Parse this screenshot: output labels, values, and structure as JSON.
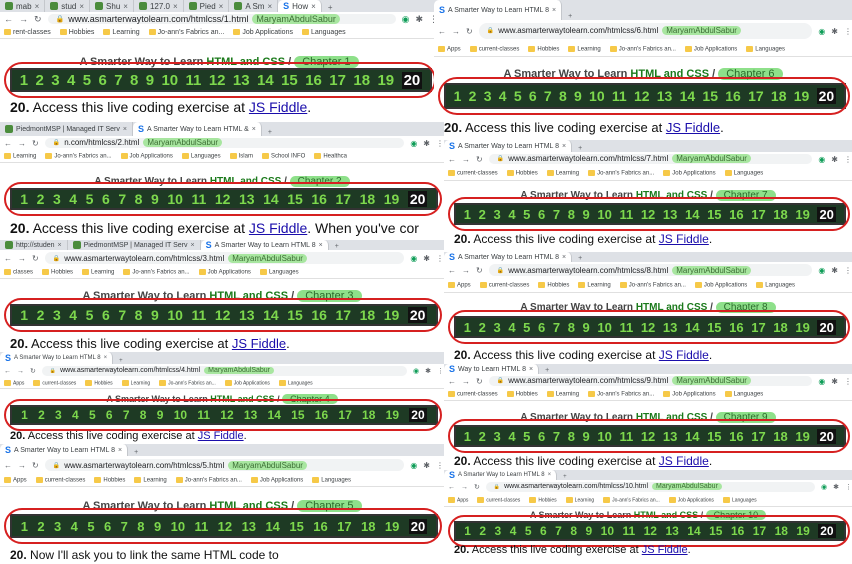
{
  "shots": [
    {
      "tabs": [
        "mab",
        "stud",
        "Shu",
        "127.0",
        "Pied",
        "A Sm",
        "How"
      ],
      "url": "www.asmarterwaytolearn.com/htmlcss/1.html",
      "user": "MaryamAbdulSabur",
      "bookmarks": [
        "rent-classes",
        "Hobbies",
        "Learning",
        "Jo-ann's Fabrics an...",
        "Job Applications",
        "Languages"
      ],
      "title_prefix": "A Smarter Way to Learn",
      "title_highlight": "HTML and CSS",
      "chapter": "Chapter 1",
      "exercise_num": "20.",
      "exercise_text": "Access this live coding exercise at",
      "link_text": "JS Fiddle",
      "trailing": "."
    },
    {
      "tabs": [
        "A Smarter Way to Learn HTML 8"
      ],
      "url": "www.asmarterwaytolearn.com/htmlcss/6.html",
      "user": "MaryamAbdulSabur",
      "bookmarks": [
        "Apps",
        "current-classes",
        "Hobbies",
        "Learning",
        "Jo-ann's Fabrics an...",
        "Job Applications",
        "Languages"
      ],
      "title_prefix": "A Smarter Way to Learn",
      "title_highlight": "HTML and CSS",
      "chapter": "Chapter 6",
      "exercise_num": "20.",
      "exercise_text": "Access this live coding exercise at",
      "link_text": "JS Fiddle",
      "trailing": "."
    },
    {
      "tabs": [
        "PiedmontMSP | Managed IT Serv",
        "A Smarter Way to Learn HTML &"
      ],
      "url": "n.com/htmlcss/2.html",
      "user": "MaryamAbdulSabur",
      "bookmarks": [
        "Learning",
        "Jo-ann's Fabrics an...",
        "Job Applications",
        "Languages",
        "Islam",
        "School INFO",
        "Healthca"
      ],
      "title_prefix": "A Smarter Way to Learn",
      "title_highlight": "HTML and CSS",
      "chapter": "Chapter 2",
      "exercise_num": "20.",
      "exercise_text": "Access this live coding exercise at",
      "link_text": "JS Fiddle",
      "trailing": ". When you've cor"
    },
    {
      "tabs": [
        "A Smarter Way to Learn HTML 8"
      ],
      "url": "www.asmarterwaytolearn.com/htmlcss/7.html",
      "user": "MaryamAbdulSabur",
      "bookmarks": [
        "current-classes",
        "Hobbies",
        "Learning",
        "Jo-ann's Fabrics an...",
        "Job Applications",
        "Languages"
      ],
      "title_prefix": "A Smarter Way to Learn",
      "title_highlight": "HTML and CSS",
      "chapter": "Chapter 7",
      "exercise_num": "20.",
      "exercise_text": "Access this live coding exercise at",
      "link_text": "JS Fiddle",
      "trailing": "."
    },
    {
      "tabs": [
        "http://studen",
        "PiedmontMSP | Managed IT Serv",
        "A Smarter Way to Learn HTML 8"
      ],
      "url": "www.asmarterwaytolearn.com/htmlcss/3.html",
      "user": "MaryamAbdulSabur",
      "bookmarks": [
        "classes",
        "Hobbies",
        "Learning",
        "Jo-ann's Fabrics an...",
        "Job Applications",
        "Languages"
      ],
      "title_prefix": "A Smarter Way to Learn",
      "title_highlight": "HTML and CSS",
      "chapter": "Chapter 3",
      "exercise_num": "20.",
      "exercise_text": "Access this live coding exercise at",
      "link_text": "JS Fiddle",
      "trailing": "."
    },
    {
      "tabs": [
        "A Smarter Way to Learn HTML 8"
      ],
      "url": "www.asmarterwaytolearn.com/htmlcss/8.html",
      "user": "MaryamAbdulSabur",
      "bookmarks": [
        "Apps",
        "current-classes",
        "Hobbies",
        "Learning",
        "Jo-ann's Fabrics an...",
        "Job Applications",
        "Languages"
      ],
      "title_prefix": "A Smarter Way to Learn",
      "title_highlight": "HTML and CSS",
      "chapter": "Chapter 8",
      "exercise_num": "20.",
      "exercise_text": "Access this live coding exercise at",
      "link_text": "JS Fiddle",
      "trailing": "."
    },
    {
      "tabs": [
        "A Smarter Way to Learn HTML 8"
      ],
      "url": "www.asmarterwaytolearn.com/htmlcss/4.html",
      "user": "MaryamAbdulSabur",
      "bookmarks": [
        "Apps",
        "current-classes",
        "Hobbies",
        "Learning",
        "Jo-ann's Fabrics an...",
        "Job Applications",
        "Languages"
      ],
      "title_prefix": "A Smarter Way to Learn",
      "title_highlight": "HTML and CSS",
      "chapter": "Chapter 4",
      "exercise_num": "20.",
      "exercise_text": "Access this live coding exercise at",
      "link_text": "JS Fiddle",
      "trailing": "."
    },
    {
      "tabs": [
        "Way to Learn HTML 8"
      ],
      "url": "www.asmarterwaytolearn.com/htmlcss/9.html",
      "user": "MaryamAbdulSabur",
      "bookmarks": [
        "current-classes",
        "Hobbies",
        "Learning",
        "Jo-ann's Fabrics an...",
        "Job Applications",
        "Languages"
      ],
      "title_prefix": "A Smarter Way to Learn",
      "title_highlight": "HTML and CSS",
      "chapter": "Chapter 9",
      "exercise_num": "20.",
      "exercise_text": "Access this live coding exercise at",
      "link_text": "JS Fiddle",
      "trailing": "."
    },
    {
      "tabs": [
        "A Smarter Way to Learn HTML 8"
      ],
      "url": "www.asmarterwaytolearn.com/htmlcss/5.html",
      "user": "MaryamAbdulSabur",
      "bookmarks": [
        "Apps",
        "current-classes",
        "Hobbies",
        "Learning",
        "Jo-ann's Fabrics an...",
        "Job Applications",
        "Languages"
      ],
      "title_prefix": "A Smarter Way to Learn",
      "title_highlight": "HTML and CSS",
      "chapter": "Chapter 5",
      "exercise_num": "20.",
      "exercise_text": "Now I'll ask you to link the same HTML code to",
      "link_text": "",
      "trailing": ""
    },
    {
      "tabs": [
        "A Smarter Way to Learn HTML 8"
      ],
      "url": "www.asmarterwaytolearn.com/htmlcss/10.html",
      "user": "MaryamAbdulSabur",
      "bookmarks": [
        "Apps",
        "current-classes",
        "Hobbies",
        "Learning",
        "Jo-ann's Fabrics an...",
        "Job Applications",
        "Languages"
      ],
      "title_prefix": "A Smarter Way to Learn",
      "title_highlight": "HTML and CSS",
      "chapter": "Chapter 10",
      "exercise_num": "20.",
      "exercise_text": "Access this live coding exercise at",
      "link_text": "JS Fiddle",
      "trailing": "."
    }
  ],
  "numbers": [
    "1",
    "2",
    "3",
    "4",
    "5",
    "6",
    "7",
    "8",
    "9",
    "10",
    "11",
    "12",
    "13",
    "14",
    "15",
    "16",
    "17",
    "18",
    "19",
    "20"
  ],
  "colors": {
    "bar_bg": "#1e3a24",
    "number_green": "#7dd84d",
    "highlight_green": "#8ee08a",
    "red_circle": "#d62020",
    "link_blue": "#1a0dab"
  }
}
